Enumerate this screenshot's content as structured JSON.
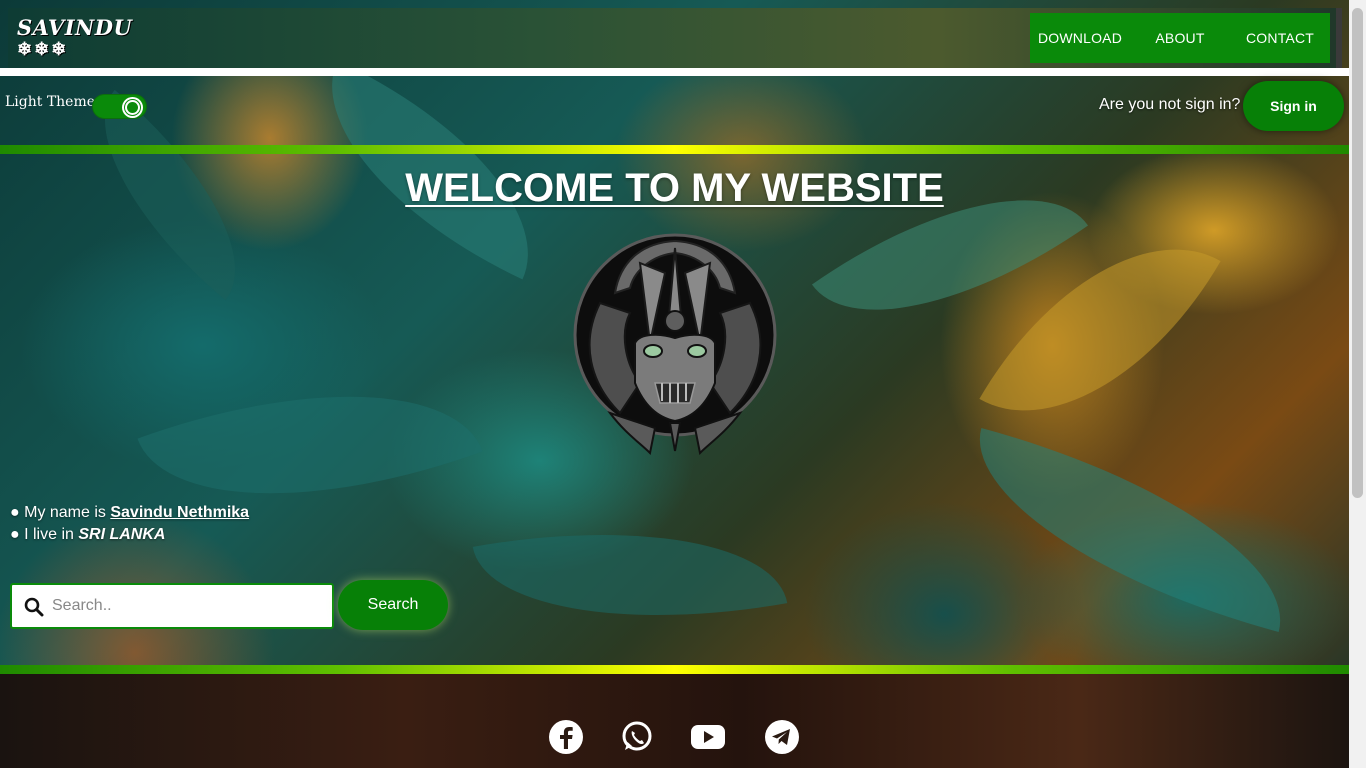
{
  "brand": {
    "name": "SAVINDU",
    "flakes": "❄❄❄"
  },
  "nav": {
    "items": [
      "DOWNLOAD",
      "ABOUT",
      "CONTACT"
    ]
  },
  "theme": {
    "label": "Light Theme",
    "enabled": true
  },
  "signin": {
    "question": "Are you not sign in?",
    "button": "Sign in"
  },
  "hero": {
    "title": "WELCOME TO MY WEBSITE"
  },
  "info": {
    "line1_prefix": "● My name is ",
    "line1_name": "Savindu Nethmika",
    "line2_prefix": "● I live in ",
    "line2_place": "SRI LANKA"
  },
  "search": {
    "placeholder": "Search..",
    "button": "Search"
  },
  "social": [
    "facebook-icon",
    "whatsapp-icon",
    "youtube-icon",
    "telegram-icon"
  ],
  "colors": {
    "accent": "#078007",
    "stripe_mid": "#ffff00"
  }
}
